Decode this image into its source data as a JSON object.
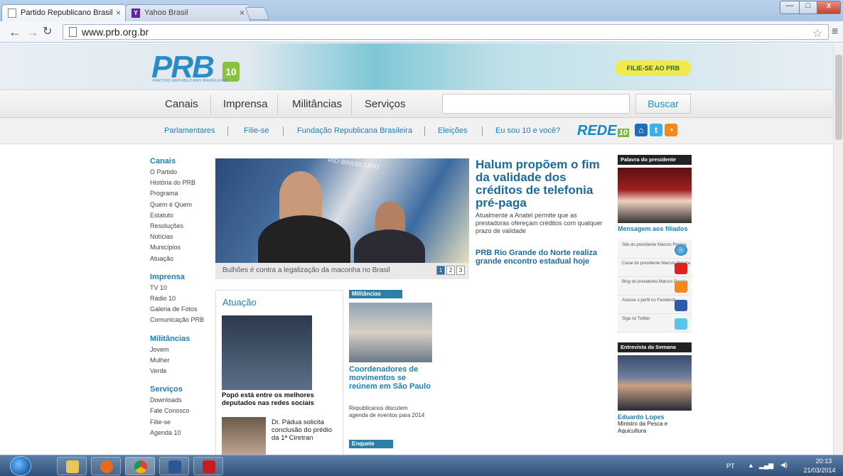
{
  "browser": {
    "tabs": [
      {
        "title": "Partido Republicano Brasil",
        "close": "×"
      },
      {
        "title": "Yahoo Brasil",
        "close": "×"
      }
    ],
    "url": "www.prb.org.br",
    "controls": {
      "minimize": "—",
      "maximize": "□",
      "close": "x"
    }
  },
  "header": {
    "logo_text": "PRB",
    "logo_number": "10",
    "logo_subtitle": "PARTIDO REPUBLICANO BRASILEIRO",
    "join_button": "FILIE-SE AO PRB"
  },
  "main_nav": {
    "items": [
      "Canais",
      "Imprensa",
      "Militâncias",
      "Serviços"
    ],
    "search_button": "Buscar"
  },
  "sub_nav": {
    "items": [
      "Parlamentares",
      "Filie-se",
      "Fundação Republicana Brasileira",
      "Eleições",
      "Eu sou 10 e você?"
    ],
    "rede_label": "REDE",
    "rede_number": "10"
  },
  "left_menu": {
    "sections": [
      {
        "title": "Canais",
        "links": [
          "O Partido",
          "História do PRB",
          "Programa",
          "Quem é Quem",
          "Estatuto",
          "Resoluções",
          "Notícias",
          "Municípios",
          "Atuação"
        ]
      },
      {
        "title": "Imprensa",
        "links": [
          "TV 10",
          "Rádio 10",
          "Galeria de Fotos",
          "Comunicação PRB"
        ]
      },
      {
        "title": "Militâncias",
        "links": [
          "Jovem",
          "Mulher",
          "Verde"
        ]
      },
      {
        "title": "Serviços",
        "links": [
          "Downloads",
          "Fale Conosco",
          "Filie-se",
          "Agenda 10"
        ]
      }
    ]
  },
  "featured": {
    "caption": "Bulhões é contra a legalização da maconha no Brasil",
    "pages": [
      "1",
      "2",
      "3"
    ],
    "banner_text": "RIO BRASILEIRO"
  },
  "headline": {
    "title": "Halum propõem o fim da validade dos créditos de telefonia pré-paga",
    "summary": "Atualmente a Anatel permite que as prestadoras ofereçam créditos com qualquer prazo de validade",
    "secondary": "PRB Rio Grande do Norte realiza grande encontro estadual hoje"
  },
  "atuacao": {
    "title": "Atuação",
    "story1": "Popó está entre os melhores deputados nas redes sociais",
    "story2": "Dr. Pádua solicita conclusão do prédio da 1ª Ciretran"
  },
  "militancias": {
    "label": "Militâncias",
    "headline": "Coordenadores de movimentos se reúnem em São Paulo",
    "summary": "Republicanos discutem agenda de eventos para 2014",
    "enquete_label": "Enquete"
  },
  "right_col": {
    "president_box": "Palavra do presidente",
    "president_link": "Mensagem aos filiados",
    "links": [
      "Site do presidente Marcos Pereira",
      "Canal do presidente Marcos Pereira",
      "Blog do presidente Marcos Pereira",
      "Acesse o perfil no Facebook",
      "Siga no Twitter"
    ],
    "interview_box": "Entrevista da Semana",
    "interview_name": "Eduardo Lopes",
    "interview_role": "Ministro da Pesca e Aquicultura"
  },
  "taskbar": {
    "lang": "PT",
    "time": "20:13",
    "date": "21/03/2014"
  },
  "colors": {
    "brand_blue": "#1d7fb0",
    "brand_green": "#88c23f",
    "join_yellow": "#f4e94a"
  }
}
